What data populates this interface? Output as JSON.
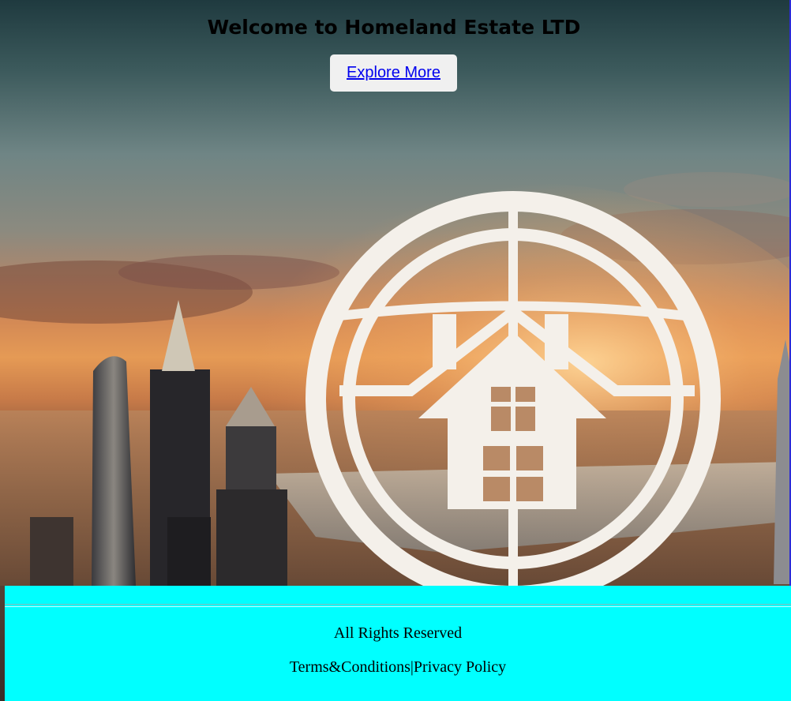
{
  "header": {
    "title": "Welcome to Homeland Estate LTD",
    "cta_label": "Explore More"
  },
  "footer": {
    "rights": "All Rights Reserved",
    "terms_label": "Terms&Conditions",
    "separator": "|",
    "privacy_label": "Privacy Policy",
    "background_color": "#00ffff"
  },
  "colors": {
    "link": "#0000ee",
    "button_bg": "#f0f0f0"
  },
  "hero_image": {
    "icon": "house-in-circle-logo"
  }
}
